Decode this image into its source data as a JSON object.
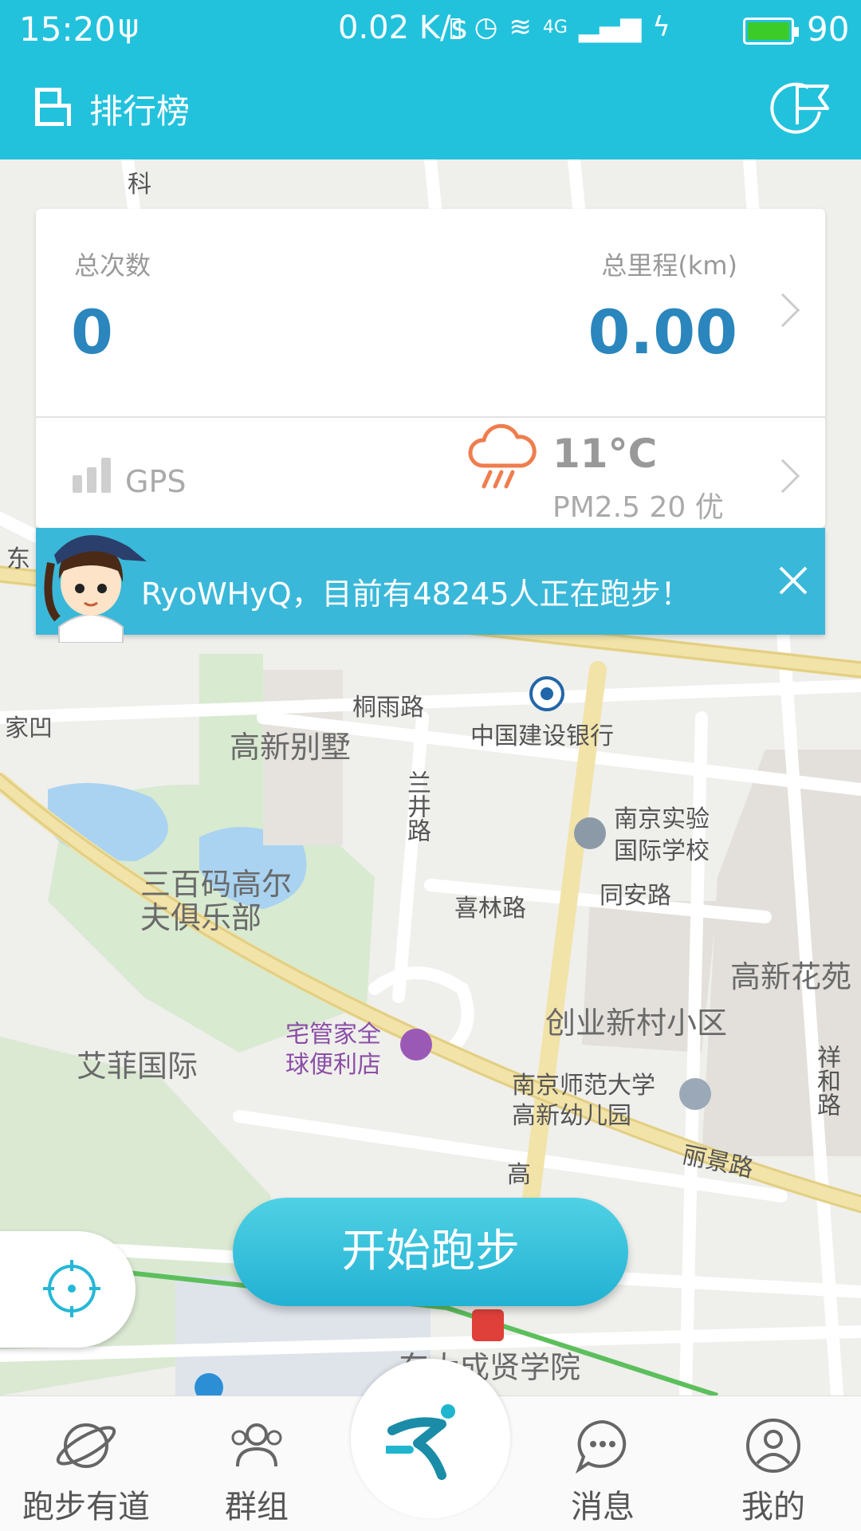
{
  "status_bar": {
    "time": "15:20",
    "speed": "0.02 K/s",
    "network": "4G",
    "battery_percent": "90",
    "battery_color": "#3ccc29"
  },
  "header": {
    "title": "排行榜",
    "left_icon": "ranking-icon",
    "right_icon": "flag-icon",
    "bg_color": "#22c2dd"
  },
  "stats": {
    "total_count_label": "总次数",
    "total_count_value": "0",
    "total_distance_label": "总里程(km)",
    "total_distance_value": "0.00",
    "value_color": "#2a86bc",
    "gps_label": "GPS",
    "temperature": "11°C",
    "air_quality": "PM2.5 20 优",
    "weather_icon": "rain-cloud-icon"
  },
  "banner": {
    "text": "RyoWHyQ，目前有48245人正在跑步！",
    "bg_color": "#3ab8d9"
  },
  "map": {
    "labels": [
      "桐雨路",
      "中国建设银行",
      "高新别墅",
      "兰井路",
      "南京实验",
      "国际学校",
      "三百码高尔",
      "夫俱乐部",
      "喜林路",
      "同安路",
      "高新花苑",
      "创业新村小区",
      "宅管家全",
      "球便利店",
      "艾菲国际",
      "南京师范大学",
      "高新幼儿园",
      "祥和路",
      "丽景路",
      "东大成贤学院",
      "家凹",
      "东",
      "高",
      "科"
    ]
  },
  "start_button": {
    "label": "开始跑步"
  },
  "bottom_nav": {
    "items": [
      {
        "label": "跑步有道",
        "icon": "planet-icon"
      },
      {
        "label": "群组",
        "icon": "group-icon"
      },
      {
        "label": "",
        "icon": "run-icon"
      },
      {
        "label": "消息",
        "icon": "message-icon"
      },
      {
        "label": "我的",
        "icon": "profile-icon"
      }
    ]
  }
}
